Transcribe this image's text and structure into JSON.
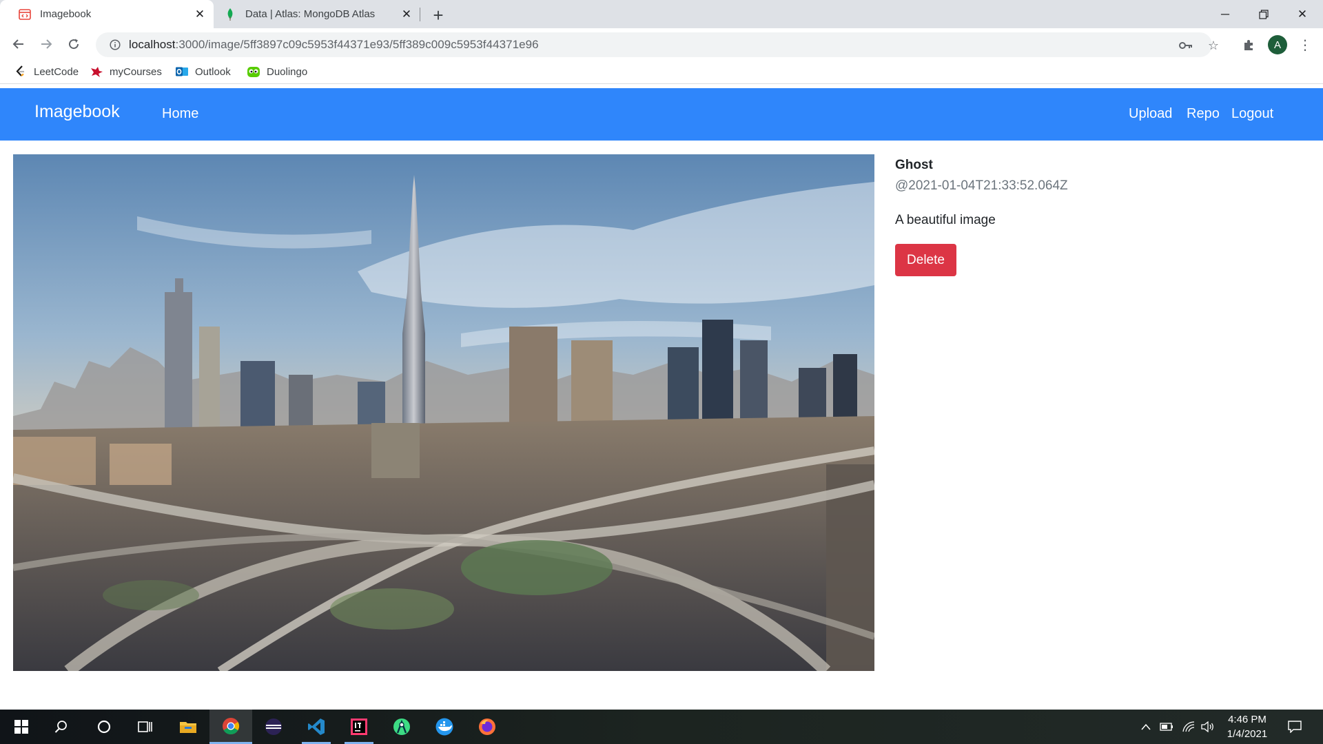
{
  "browser": {
    "tabs": [
      {
        "title": "Imagebook",
        "active": true
      },
      {
        "title": "Data | Atlas: MongoDB Atlas",
        "active": false
      }
    ],
    "address": {
      "host": "localhost",
      "path": ":3000/image/5ff3897c09c5953f44371e93/5ff389c009c5953f44371e96"
    },
    "profile_initial": "A",
    "bookmarks": [
      {
        "label": "LeetCode",
        "icon": "leetcode-icon"
      },
      {
        "label": "myCourses",
        "icon": "mycourses-icon"
      },
      {
        "label": "Outlook",
        "icon": "outlook-icon"
      },
      {
        "label": "Duolingo",
        "icon": "duolingo-icon"
      }
    ]
  },
  "navbar": {
    "brand": "Imagebook",
    "left_links": [
      "Home"
    ],
    "right_links": [
      "Upload",
      "Repo",
      "Logout"
    ],
    "color": "#2f86fb"
  },
  "image_post": {
    "author": "Ghost",
    "timestamp": "@2021-01-04T21:33:52.064Z",
    "description": "A beautiful image",
    "delete_label": "Delete",
    "delete_color": "#dc3545"
  },
  "taskbar": {
    "apps": [
      "start-icon",
      "search-icon",
      "cortana-icon",
      "task-view-icon",
      "file-explorer-icon",
      "chrome-icon",
      "eclipse-icon",
      "vscode-icon",
      "intellij-icon",
      "android-studio-icon",
      "docker-icon",
      "firefox-icon"
    ],
    "time": "4:46 PM",
    "date": "1/4/2021"
  }
}
